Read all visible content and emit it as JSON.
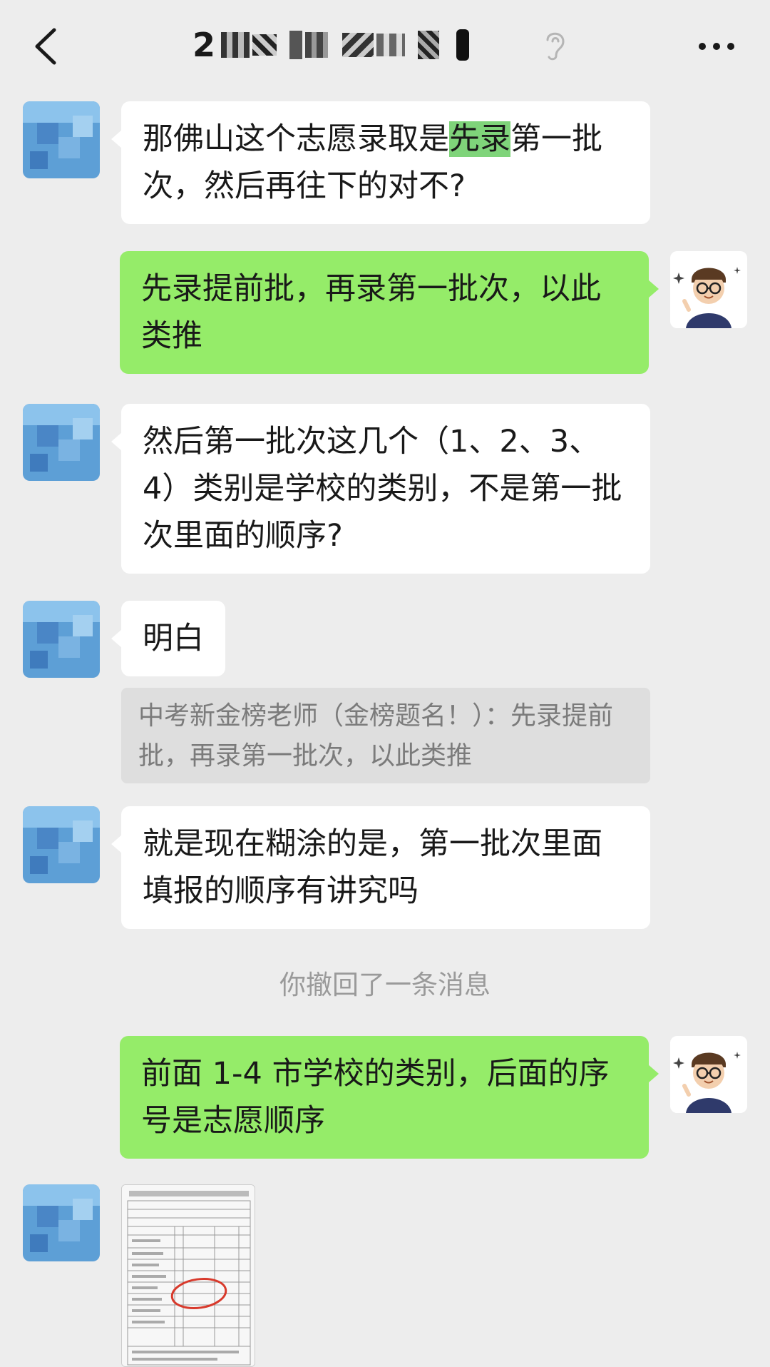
{
  "header": {
    "title_visible": "2",
    "back_icon": "chevron-left-icon",
    "ear_icon": "ear-icon",
    "more_icon": "more-dots-icon"
  },
  "messages": [
    {
      "sender": "other",
      "text_a": "那佛山这个志愿录取是",
      "text_hl": "先录",
      "text_b": "第一批次，然后再往下的对不?"
    },
    {
      "sender": "self",
      "text": "先录提前批，再录第一批次，以此类推"
    },
    {
      "sender": "other",
      "text": "然后第一批次这几个（1、2、3、4）类别是学校的类别，不是第一批次里面的顺序?"
    },
    {
      "sender": "other",
      "text": "明白"
    },
    {
      "sender": "other",
      "text": "就是现在糊涂的是，第一批次里面填报的顺序有讲究吗"
    },
    {
      "sender": "self",
      "text": "前面 1-4 市学校的类别，后面的序号是志愿顺序"
    }
  ],
  "quote": {
    "text": "中考新金榜老师（金榜题名！）：先录提前批，再录第一批次，以此类推"
  },
  "system": {
    "recall_text": "你撤回了一条消息"
  },
  "colors": {
    "background": "#ededed",
    "self_bubble": "#95ec69",
    "other_bubble": "#ffffff",
    "highlight": "#7fd47a"
  }
}
